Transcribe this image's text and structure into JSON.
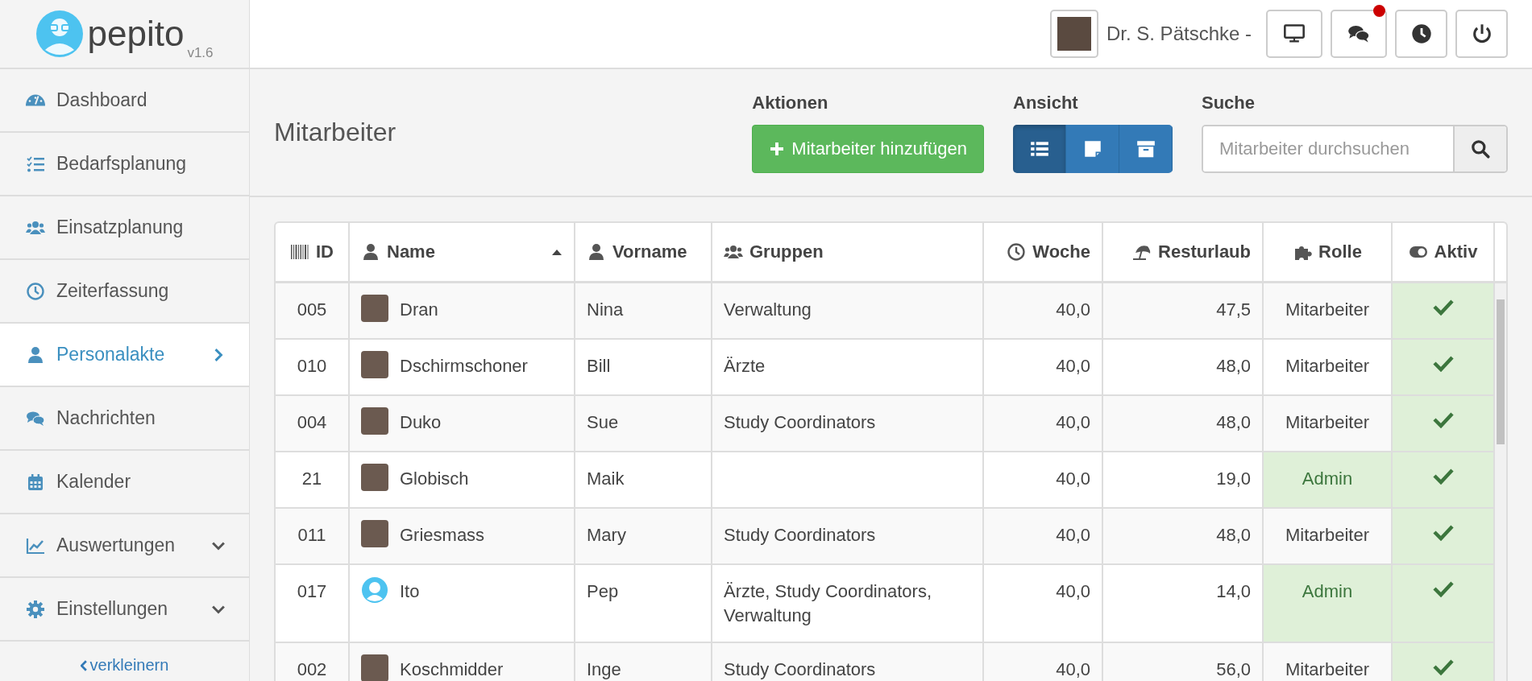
{
  "logo": {
    "name": "pepito",
    "version": "v1.6"
  },
  "header": {
    "user": "Dr. S. Pätschke -",
    "buttons": [
      {
        "unread": false
      },
      {
        "unread": true
      },
      {
        "unread": false
      },
      {
        "unread": false
      }
    ]
  },
  "sidebar": {
    "items": [
      {
        "label": "Dashboard",
        "selected": false,
        "expandable": false
      },
      {
        "label": "Bedarfsplanung",
        "selected": false,
        "expandable": false
      },
      {
        "label": "Einsatzplanung",
        "selected": false,
        "expandable": false
      },
      {
        "label": "Zeiterfassung",
        "selected": false,
        "expandable": false
      },
      {
        "label": "Personalakte",
        "selected": true,
        "expandable": false
      },
      {
        "label": "Nachrichten",
        "selected": false,
        "expandable": false
      },
      {
        "label": "Kalender",
        "selected": false,
        "expandable": false
      },
      {
        "label": "Auswertungen",
        "selected": false,
        "expandable": true
      },
      {
        "label": "Einstellungen",
        "selected": false,
        "expandable": true
      }
    ],
    "collapse": "verkleinern"
  },
  "page_title": "Mitarbeiter",
  "actions": {
    "label": "Aktionen",
    "add_button": "Mitarbeiter hinzufügen"
  },
  "view": {
    "label": "Ansicht",
    "options": [
      {
        "selected": true
      },
      {
        "selected": false
      },
      {
        "selected": false
      }
    ]
  },
  "search": {
    "label": "Suche",
    "placeholder": "Mitarbeiter durchsuchen"
  },
  "table": {
    "columns": [
      {
        "label": "ID",
        "sorted": false
      },
      {
        "label": "Name",
        "sorted": true
      },
      {
        "label": "Vorname",
        "sorted": false
      },
      {
        "label": "Gruppen",
        "sorted": false
      },
      {
        "label": "Woche",
        "sorted": false
      },
      {
        "label": "Resturlaub",
        "sorted": false
      },
      {
        "label": "Rolle",
        "sorted": false
      },
      {
        "label": "Aktiv",
        "sorted": false
      }
    ],
    "rows": [
      {
        "id": "005",
        "kind": "photo",
        "name": "Dran",
        "vorname": "Nina",
        "gruppen": "Verwaltung",
        "woche": "40,0",
        "resturlaub": "47,5",
        "rolle": "Mitarbeiter",
        "admin": false,
        "active": true
      },
      {
        "id": "010",
        "kind": "photo",
        "name": "Dschirmschoner",
        "vorname": "Bill",
        "gruppen": "Ärzte",
        "woche": "40,0",
        "resturlaub": "48,0",
        "rolle": "Mitarbeiter",
        "admin": false,
        "active": true
      },
      {
        "id": "004",
        "kind": "photo",
        "name": "Duko",
        "vorname": "Sue",
        "gruppen": "Study Coordinators",
        "woche": "40,0",
        "resturlaub": "48,0",
        "rolle": "Mitarbeiter",
        "admin": false,
        "active": true
      },
      {
        "id": "21",
        "kind": "photo",
        "name": "Globisch",
        "vorname": "Maik",
        "gruppen": "",
        "woche": "40,0",
        "resturlaub": "19,0",
        "rolle": "Admin",
        "admin": true,
        "active": true
      },
      {
        "id": "011",
        "kind": "photo",
        "name": "Griesmass",
        "vorname": "Mary",
        "gruppen": "Study Coordinators",
        "woche": "40,0",
        "resturlaub": "48,0",
        "rolle": "Mitarbeiter",
        "admin": false,
        "active": true
      },
      {
        "id": "017",
        "kind": "logo",
        "name": "Ito",
        "vorname": "Pep",
        "gruppen": "Ärzte, Study Coordinators, Verwaltung",
        "woche": "40,0",
        "resturlaub": "14,0",
        "rolle": "Admin",
        "admin": true,
        "active": true
      },
      {
        "id": "002",
        "kind": "photo",
        "name": "Koschmidder",
        "vorname": "Inge",
        "gruppen": "Study Coordinators",
        "woche": "40,0",
        "resturlaub": "56,0",
        "rolle": "Mitarbeiter",
        "admin": false,
        "active": true
      }
    ]
  }
}
